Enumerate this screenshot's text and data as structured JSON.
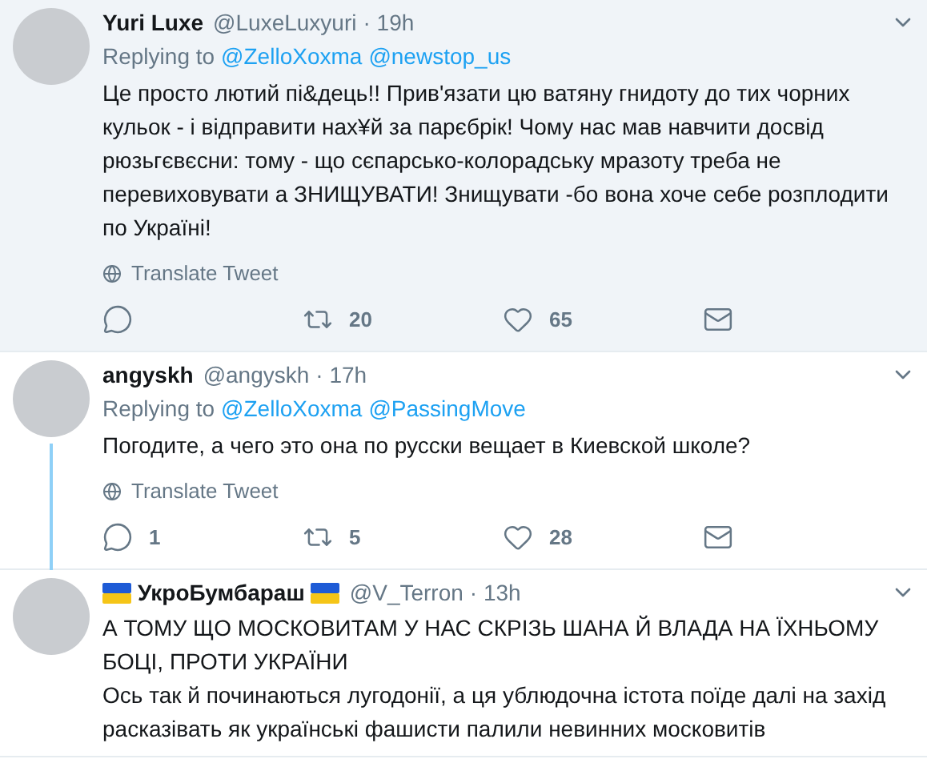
{
  "tweets": [
    {
      "name": "Yuri Luxe",
      "handle": "@LuxeLuxyuri",
      "time": "· 19h",
      "highlighted": true,
      "thread_continues": false,
      "flagged": false,
      "replying_label": "Replying to",
      "replying_to": [
        "@ZelloXoxma",
        "@newstop_us"
      ],
      "body": [
        "Це просто лютий пі&дець!! Прив'язати цю ватяну гнидоту до тих чорних кульок - і відправити нах¥й за парєбрік!  Чому нас мав навчити досвід рюзьгєвєсни: тому - що сєпарсько-колорадську мразоту треба не перевиховувати а ЗНИЩУВАТИ! Знищувати -бо вона хоче себе розплодити по Україні!"
      ],
      "translate": "Translate Tweet",
      "actions": [
        {
          "kind": "reply"
        },
        {
          "kind": "retweet",
          "count": "20"
        },
        {
          "kind": "like",
          "count": "65"
        },
        {
          "kind": "message"
        }
      ]
    },
    {
      "name": "angyskh",
      "handle": "@angyskh",
      "time": "· 17h",
      "highlighted": false,
      "thread_continues": true,
      "flagged": false,
      "replying_label": "Replying to",
      "replying_to": [
        "@ZelloXoxma",
        "@PassingMove"
      ],
      "body": [
        "Погодите,  а чего это она по русски вещает в Киевской школе?"
      ],
      "translate": "Translate Tweet",
      "actions": [
        {
          "kind": "reply",
          "count": "1"
        },
        {
          "kind": "retweet",
          "count": "5"
        },
        {
          "kind": "like",
          "count": "28"
        },
        {
          "kind": "message"
        }
      ]
    },
    {
      "name": "УкроБумбараш",
      "handle": "@V_Terron",
      "time": "· 13h",
      "highlighted": false,
      "thread_continues": false,
      "flagged": true,
      "body": [
        "А ТОМУ ЩО МОСКОВИТАМ У НАС СКРІЗЬ ШАНА Й ВЛАДА НА ЇХНЬОМУ БОЦІ, ПРОТИ УКРАЇНИ",
        "Ось так й починаються лугодонії, а ця ублюдочна істота поїде далі на захід расказівать як українські фашисти палили невинних московитів"
      ]
    }
  ]
}
